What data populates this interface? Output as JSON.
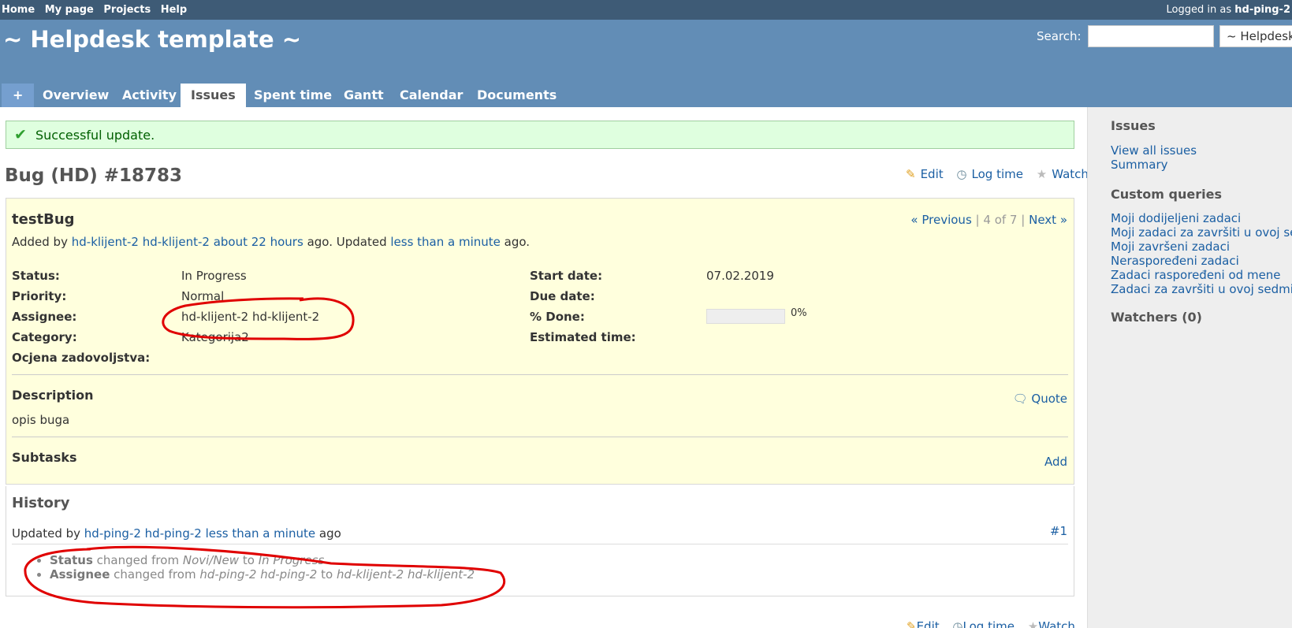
{
  "top_menu": {
    "items": [
      "Home",
      "My page",
      "Projects",
      "Help"
    ],
    "logged_in_prefix": "Logged in as",
    "user": "hd-ping-2"
  },
  "header": {
    "title": "~ Helpdesk template ~",
    "search_label": "Search:",
    "search_value": "",
    "project_select": "~ Helpdesk template ~"
  },
  "main_menu": {
    "plus": "+",
    "tabs": [
      "Overview",
      "Activity",
      "Issues",
      "Spent time",
      "Gantt",
      "Calendar",
      "Documents"
    ],
    "selected": "Issues"
  },
  "flash": {
    "message": "Successful update."
  },
  "issue": {
    "heading": "Bug (HD) #18783",
    "actions": {
      "edit": "Edit",
      "log_time": "Log time",
      "watch": "Watch"
    },
    "subject": "testBug",
    "added_by_prefix": "Added by",
    "author": "hd-klijent-2 hd-klijent-2",
    "created_ago": "about 22 hours",
    "updated_prefix": "ago. Updated",
    "updated_ago": "less than a minute",
    "suffix": "ago.",
    "nav": {
      "previous": "« Previous",
      "position": "4 of 7",
      "next": "Next »",
      "sep": "|"
    },
    "attributes": {
      "status_label": "Status:",
      "status": "In Progress",
      "priority_label": "Priority:",
      "priority": "Normal",
      "assignee_label": "Assignee:",
      "assignee": "hd-klijent-2 hd-klijent-2",
      "category_label": "Category:",
      "category": "Kategorija2",
      "ocjena_label": "Ocjena zadovoljstva:",
      "ocjena": "",
      "start_date_label": "Start date:",
      "start_date": "07.02.2019",
      "due_date_label": "Due date:",
      "due_date": "",
      "done_label": "% Done:",
      "done_text": "0%",
      "done_fraction": 0,
      "estimated_label": "Estimated time:",
      "estimated": ""
    },
    "description": {
      "heading": "Description",
      "quote": "Quote",
      "text": "opis buga"
    },
    "subtasks": {
      "heading": "Subtasks",
      "add": "Add"
    }
  },
  "history": {
    "heading": "History",
    "updated_by_prefix": "Updated by",
    "user": "hd-ping-2 hd-ping-2",
    "ago": "less than a minute",
    "ago_suffix": "ago",
    "journal_number": "#1",
    "changes": [
      {
        "field": "Status",
        "changed_from": "changed from",
        "from": "Novi/New",
        "to_word": "to",
        "to": "In Progress"
      },
      {
        "field": "Assignee",
        "changed_from": "changed from",
        "from": "hd-ping-2 hd-ping-2",
        "to_word": "to",
        "to": "hd-klijent-2 hd-klijent-2"
      }
    ]
  },
  "bottom_actions": {
    "edit": "Edit",
    "log_time": "Log time",
    "watch": "Watch"
  },
  "sidebar": {
    "issues_heading": "Issues",
    "issues_links": [
      "View all issues",
      "Summary"
    ],
    "custom_queries_heading": "Custom queries",
    "custom_queries": [
      "Moji dodijeljeni zadaci",
      "Moji zadaci za završiti u ovoj sedmici",
      "Moji završeni zadaci",
      "Neraspoređeni zadaci",
      "Zadaci raspoređeni od mene",
      "Zadaci za završiti u ovoj sedmici"
    ],
    "watchers_heading": "Watchers (0)"
  },
  "colors": {
    "top_bar": "#3e5b76",
    "header": "#628db6",
    "link": "#1b5fa3",
    "issue_bg": "#ffffdd",
    "flash_bg": "#dfffdf",
    "annotation": "#e00000"
  }
}
